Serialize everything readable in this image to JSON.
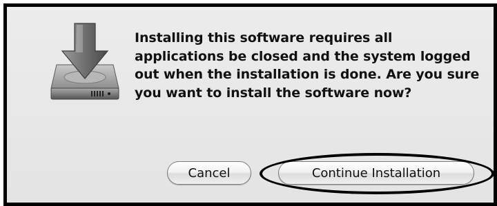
{
  "dialog": {
    "icon": "installer-disk-download-icon",
    "message": "Installing this software requires all applications be closed and the system logged out when the installation is done. Are you sure you want to install the software now?"
  },
  "buttons": {
    "cancel_label": "Cancel",
    "continue_label": "Continue Installation"
  },
  "annotation": {
    "highlight_color": "#000000"
  }
}
